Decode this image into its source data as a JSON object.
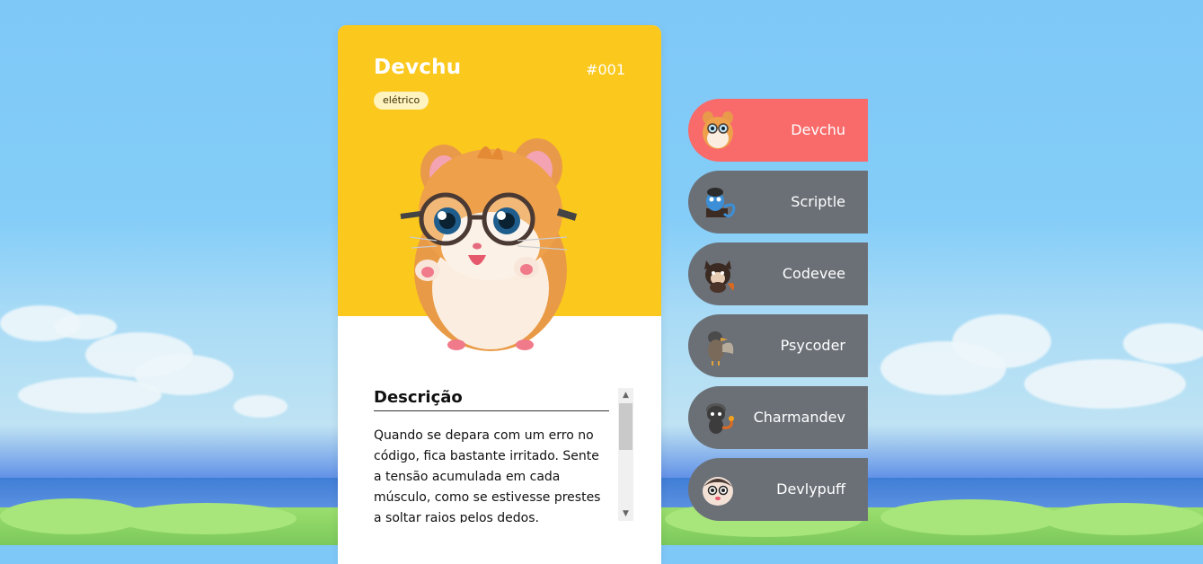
{
  "card": {
    "name": "Devchu",
    "number": "#001",
    "type": "elétrico",
    "image_icon": "hamster-with-glasses",
    "description_title": "Descrição",
    "description_text": "Quando se depara com um erro no código, fica bastante irritado. Sente a tensão acumulada em cada músculo, como se estivesse prestes a soltar raios pelos dedos.",
    "scroll_position": 0.0
  },
  "colors": {
    "card_top": "#fbc81d",
    "active_item": "#f96a6a",
    "inactive_item": "#6b7077",
    "badge_bg": "#fff3c0"
  },
  "list": [
    {
      "label": "Devchu",
      "icon": "hamster-icon",
      "active": true
    },
    {
      "label": "Scriptle",
      "icon": "blue-creature-icon",
      "active": false
    },
    {
      "label": "Codevee",
      "icon": "dark-fox-icon",
      "active": false
    },
    {
      "label": "Psycoder",
      "icon": "bird-icon",
      "active": false
    },
    {
      "label": "Charmandev",
      "icon": "lizard-icon",
      "active": false
    },
    {
      "label": "Devlypuff",
      "icon": "puffball-icon",
      "active": false
    }
  ]
}
